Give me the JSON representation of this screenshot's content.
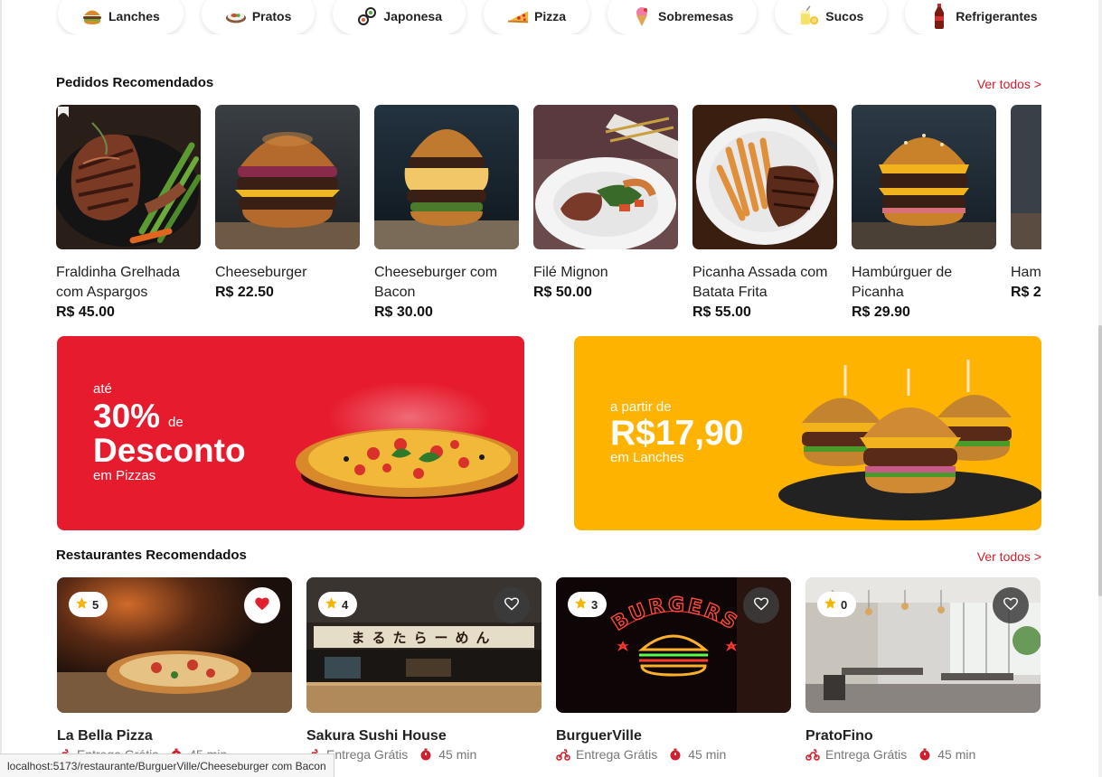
{
  "categories": [
    {
      "label": "Lanches",
      "icon": "burger-icon"
    },
    {
      "label": "Pratos",
      "icon": "dish-icon"
    },
    {
      "label": "Japonesa",
      "icon": "sushi-icon"
    },
    {
      "label": "Pizza",
      "icon": "pizza-icon"
    },
    {
      "label": "Sobremesas",
      "icon": "ice-cream-icon"
    },
    {
      "label": "Sucos",
      "icon": "juice-icon"
    },
    {
      "label": "Refrigerantes",
      "icon": "soda-icon"
    }
  ],
  "recommended_orders": {
    "title": "Pedidos Recomendados",
    "see_all": "Ver todos >",
    "items": [
      {
        "name": "Fraldinha Grelhada com Aspargos",
        "price": "R$ 45.00"
      },
      {
        "name": "Cheeseburger",
        "price": "R$ 22.50"
      },
      {
        "name": "Cheeseburger com Bacon",
        "price": "R$ 30.00"
      },
      {
        "name": "Filé Mignon",
        "price": "R$ 50.00"
      },
      {
        "name": "Picanha Assada com Batata Frita",
        "price": "R$ 55.00"
      },
      {
        "name": "Hambúrguer de Picanha",
        "price": "R$ 29.90"
      },
      {
        "name": "Ham",
        "price": "R$ 2"
      }
    ]
  },
  "banners": {
    "pizza": {
      "pre": "até",
      "percent": "30%",
      "de": "de",
      "main": "Desconto",
      "sub": "em Pizzas",
      "color": "#e61c2e"
    },
    "lanches": {
      "pre": "a partir de",
      "main": "R$17,90",
      "sub": "em Lanches",
      "color": "#fdb300"
    }
  },
  "recommended_restaurants": {
    "title": "Restaurantes Recomendados",
    "see_all": "Ver todos >",
    "items": [
      {
        "name": "La Bella Pizza",
        "rating": "5",
        "favorite": true,
        "delivery": "Entrega Grátis",
        "time": "45 min"
      },
      {
        "name": "Sakura Sushi House",
        "rating": "4",
        "favorite": false,
        "delivery": "Entrega Grátis",
        "time": "45 min",
        "sign_text": "まるたらーめん"
      },
      {
        "name": "BurguerVille",
        "rating": "3",
        "favorite": false,
        "delivery": "Entrega Grátis",
        "time": "45 min",
        "sign_text": "BURGERS"
      },
      {
        "name": "PratoFino",
        "rating": "0",
        "favorite": false,
        "delivery": "Entrega Grátis",
        "time": "45 min"
      }
    ]
  },
  "status_bar": {
    "url": "localhost:5173/restaurante/BurguerVille/Cheeseburger com Bacon"
  },
  "colors": {
    "accent": "#d0202d",
    "star": "#f5b400",
    "heart": "#e0202f"
  }
}
